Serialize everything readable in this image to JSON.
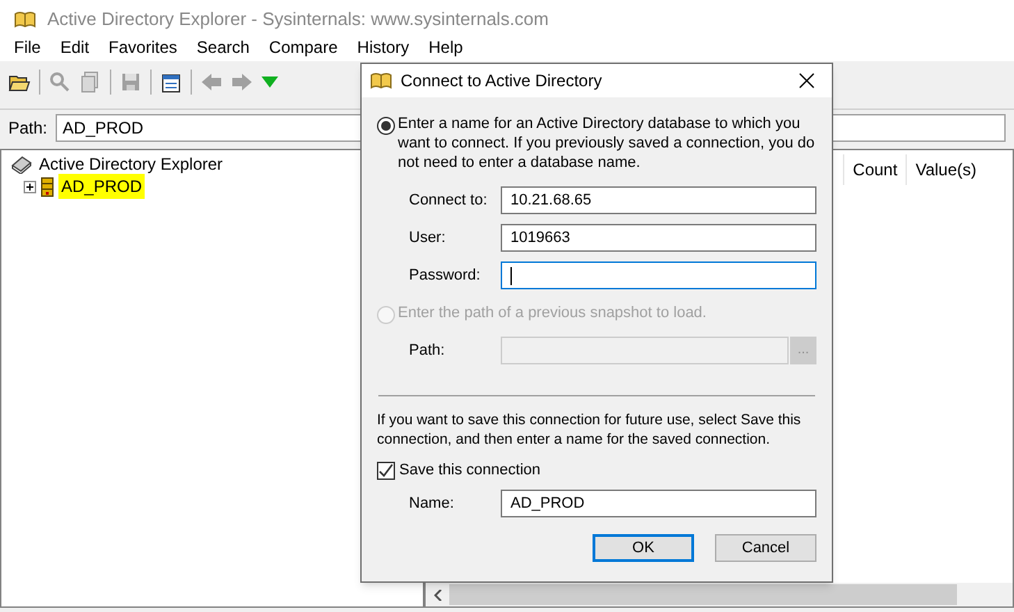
{
  "window": {
    "title": "Active Directory Explorer - Sysinternals: www.sysinternals.com"
  },
  "menu": [
    {
      "label": "File"
    },
    {
      "label": "Edit"
    },
    {
      "label": "Favorites"
    },
    {
      "label": "Search"
    },
    {
      "label": "Compare"
    },
    {
      "label": "History"
    },
    {
      "label": "Help"
    }
  ],
  "path": {
    "label": "Path:",
    "value": "AD_PROD"
  },
  "tree": [
    {
      "label": "Active Directory Explorer",
      "highlighted": false,
      "children": [
        {
          "label": "AD_PROD",
          "expanded": false,
          "highlighted": true
        }
      ]
    }
  ],
  "columns": [
    {
      "label": "Count"
    },
    {
      "label": "Value(s)"
    }
  ],
  "dialog": {
    "title": "Connect to Active Directory",
    "options": [
      {
        "label": "Enter a name for an Active Directory database to which you want to connect. If you previously saved a connection, you do not need to enter a database name.",
        "selected": true,
        "disabled": false
      },
      {
        "label": "Enter the path of a previous snapshot to load.",
        "selected": false,
        "disabled": true
      }
    ],
    "fields": [
      {
        "label": "Connect to:",
        "value": "10.21.68.65",
        "focused": false
      },
      {
        "label": "User:",
        "value": "1019663",
        "focused": false
      },
      {
        "label": "Password:",
        "focused": true
      }
    ],
    "snapshot_path": {
      "label": "Path:",
      "browse": "...",
      "disabled": true
    },
    "save_note": "If you want to save this connection for future use, select Save this connection, and then enter a name for the saved connection.",
    "save_checkbox": {
      "label": "Save this connection",
      "checked": true
    },
    "name_field": {
      "label": "Name:",
      "value": "AD_PROD"
    },
    "buttons": [
      {
        "label": "OK",
        "default": true
      },
      {
        "label": "Cancel",
        "default": false
      }
    ]
  }
}
